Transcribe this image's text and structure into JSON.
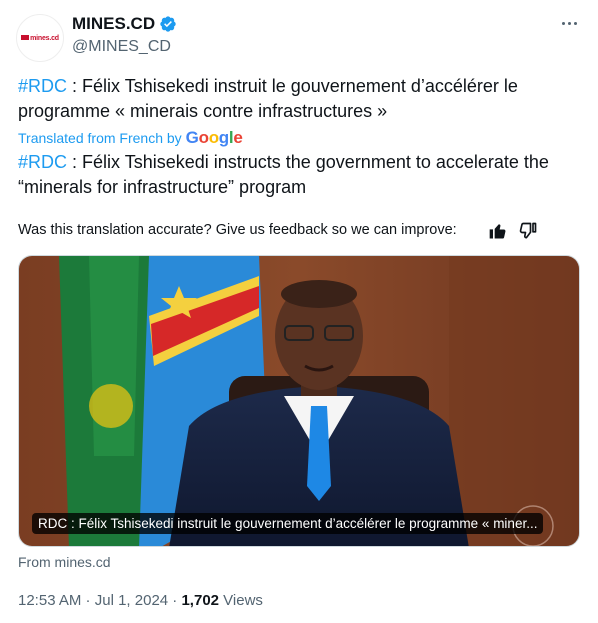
{
  "author": {
    "name": "MINES.CD",
    "handle": "@MINES_CD",
    "logo_text": "mines.cd",
    "verified_color": "#1d9bf0"
  },
  "tweet": {
    "original_hashtag": "#RDC",
    "original_text": " : Félix Tshisekedi instruit le gouvernement d’accélérer le programme « minerais contre infrastructures »",
    "translated_label": "Translated from French by",
    "translator": "Google",
    "translated_hashtag": "#RDC",
    "translated_text": " : Félix Tshisekedi instructs the government to accelerate the “minerals for infrastructure” program"
  },
  "feedback": {
    "question": "Was this translation accurate? Give us feedback so we can improve:",
    "thumbs_up_icon": "thumbs-up-icon",
    "thumbs_down_icon": "thumbs-down-icon"
  },
  "media": {
    "caption": "RDC : Félix Tshisekedi instruit le gouvernement d’accélérer le programme « miner..."
  },
  "card_source": "From mines.cd",
  "meta": {
    "time": "12:53 AM",
    "sep": " · ",
    "date": "Jul 1, 2024",
    "views_count": "1,702",
    "views_label": " Views"
  }
}
